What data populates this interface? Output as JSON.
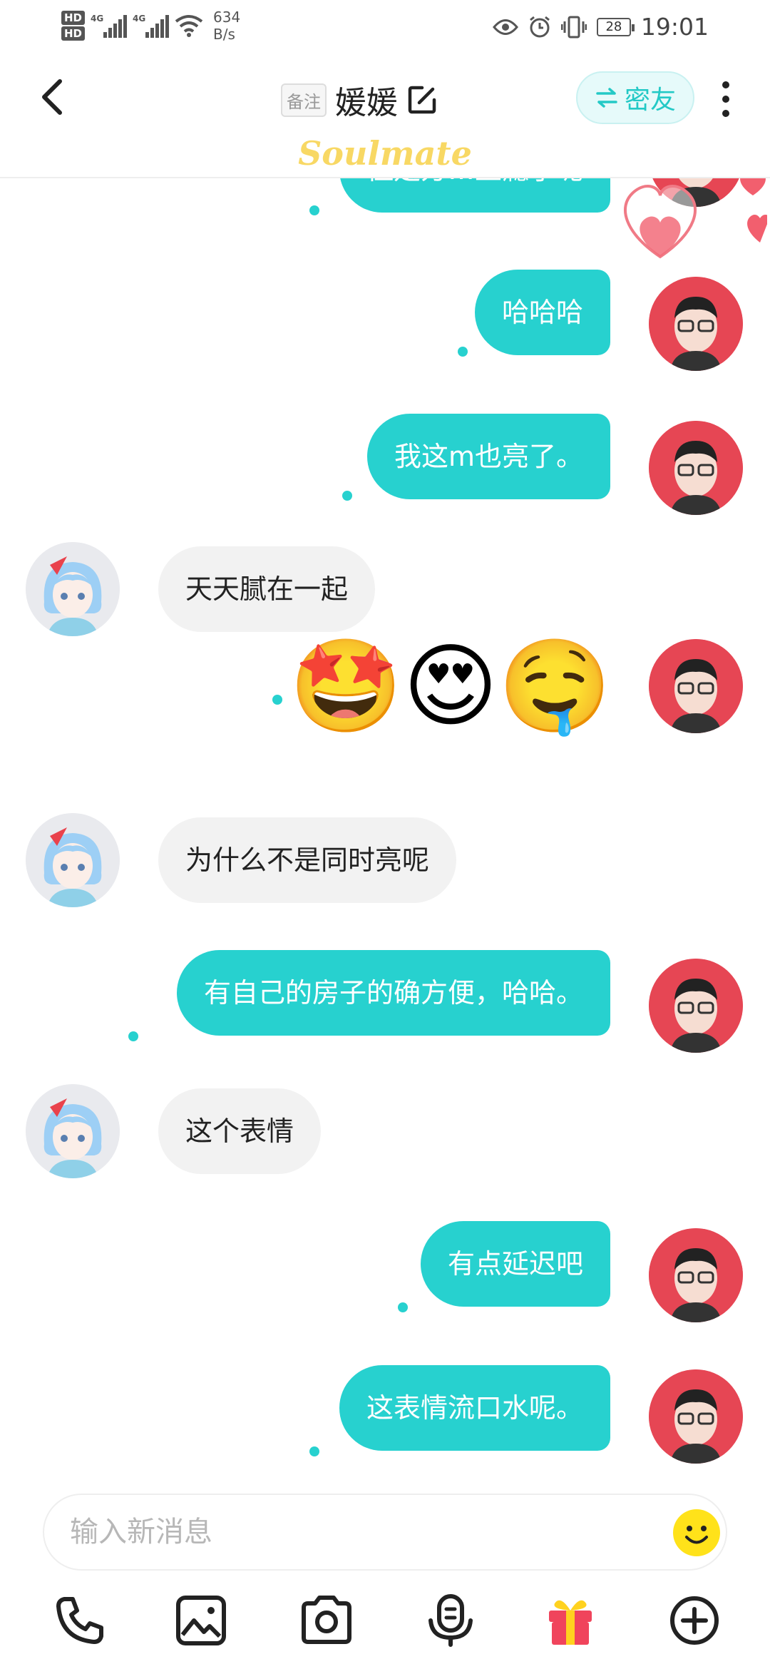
{
  "status_bar": {
    "hd_1": "HD",
    "hd_2": "HD",
    "network_1": "4G",
    "network_2": "4G",
    "speed_value": "634",
    "speed_unit": "B/s",
    "battery": "28",
    "time": "19:01",
    "icons": [
      "eye-icon",
      "alarm-icon",
      "vibrate-icon",
      "battery-icon",
      "wifi-icon",
      "signal-icon"
    ]
  },
  "header": {
    "remark_tag": "备注",
    "title": "媛媛",
    "mi_button": "密友",
    "brand": "Soulmate"
  },
  "colors": {
    "accent": "#27d1cf",
    "my_avatar_bg": "#e64654",
    "her_avatar_bg": "#e9eaee",
    "incoming_bubble": "#f2f2f2"
  },
  "messages": [
    {
      "from": "me",
      "text": "但是方…上瘾了呢",
      "partial": true
    },
    {
      "from": "me",
      "text": "哈哈哈"
    },
    {
      "from": "me",
      "text": "我这m也亮了。"
    },
    {
      "from": "her",
      "text": "天天腻在一起"
    },
    {
      "from": "me",
      "type": "emoji",
      "text": "🤩😍🤤"
    },
    {
      "from": "her",
      "text": "为什么不是同时亮呢"
    },
    {
      "from": "me",
      "text": "有自己的房子的确方便，哈哈。"
    },
    {
      "from": "her",
      "text": "这个表情"
    },
    {
      "from": "me",
      "text": "有点延迟吧"
    },
    {
      "from": "me",
      "text": "这表情流口水呢。"
    }
  ],
  "input": {
    "placeholder": "输入新消息"
  },
  "toolbar": [
    "phone-icon",
    "image-icon",
    "camera-icon",
    "voice-icon",
    "gift-icon",
    "add-icon"
  ]
}
